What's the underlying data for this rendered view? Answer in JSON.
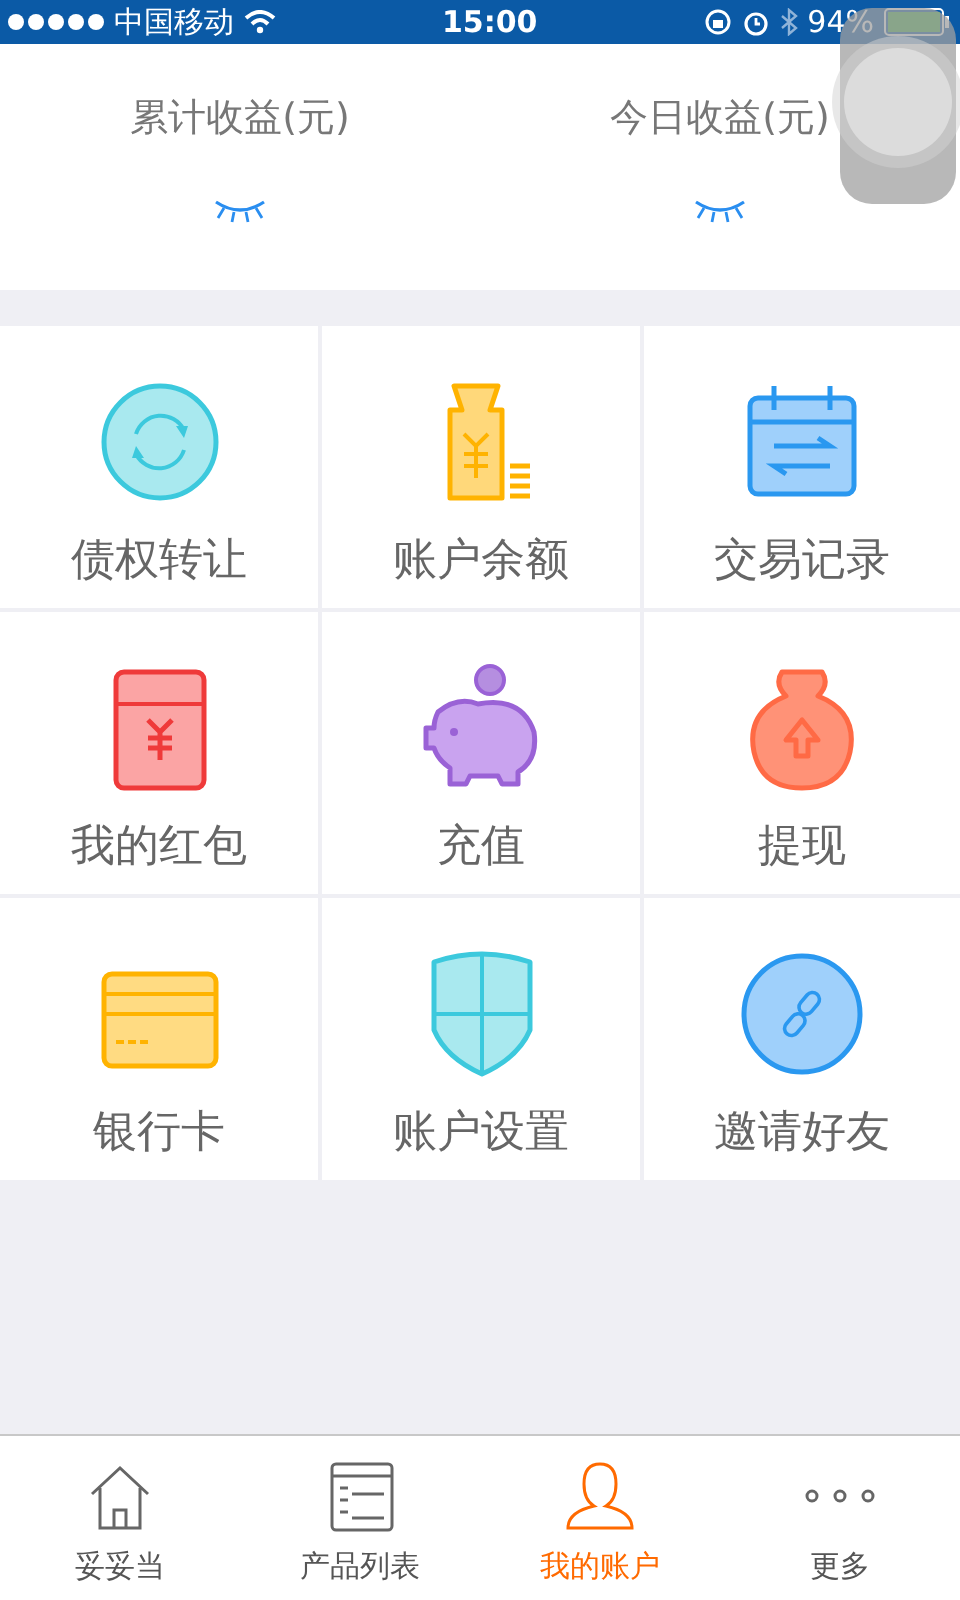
{
  "status_bar": {
    "carrier": "中国移动",
    "time": "15:00",
    "battery": "94%"
  },
  "earnings": [
    {
      "label": "累计收益(元)",
      "hidden": true
    },
    {
      "label": "今日收益(元)",
      "hidden": true
    }
  ],
  "grid": [
    {
      "label": "债权转让",
      "kind": "transfer"
    },
    {
      "label": "账户余额",
      "kind": "balance"
    },
    {
      "label": "交易记录",
      "kind": "records"
    },
    {
      "label": "我的红包",
      "kind": "redpacket"
    },
    {
      "label": "充值",
      "kind": "recharge"
    },
    {
      "label": "提现",
      "kind": "withdraw"
    },
    {
      "label": "银行卡",
      "kind": "card"
    },
    {
      "label": "账户设置",
      "kind": "settings"
    },
    {
      "label": "邀请好友",
      "kind": "invite"
    }
  ],
  "tab_bar": [
    {
      "label": "妥妥当",
      "kind": "home",
      "selected": false
    },
    {
      "label": "产品列表",
      "kind": "list",
      "selected": false
    },
    {
      "label": "我的账户",
      "kind": "account",
      "selected": true
    },
    {
      "label": "更多",
      "kind": "more",
      "selected": false
    }
  ]
}
